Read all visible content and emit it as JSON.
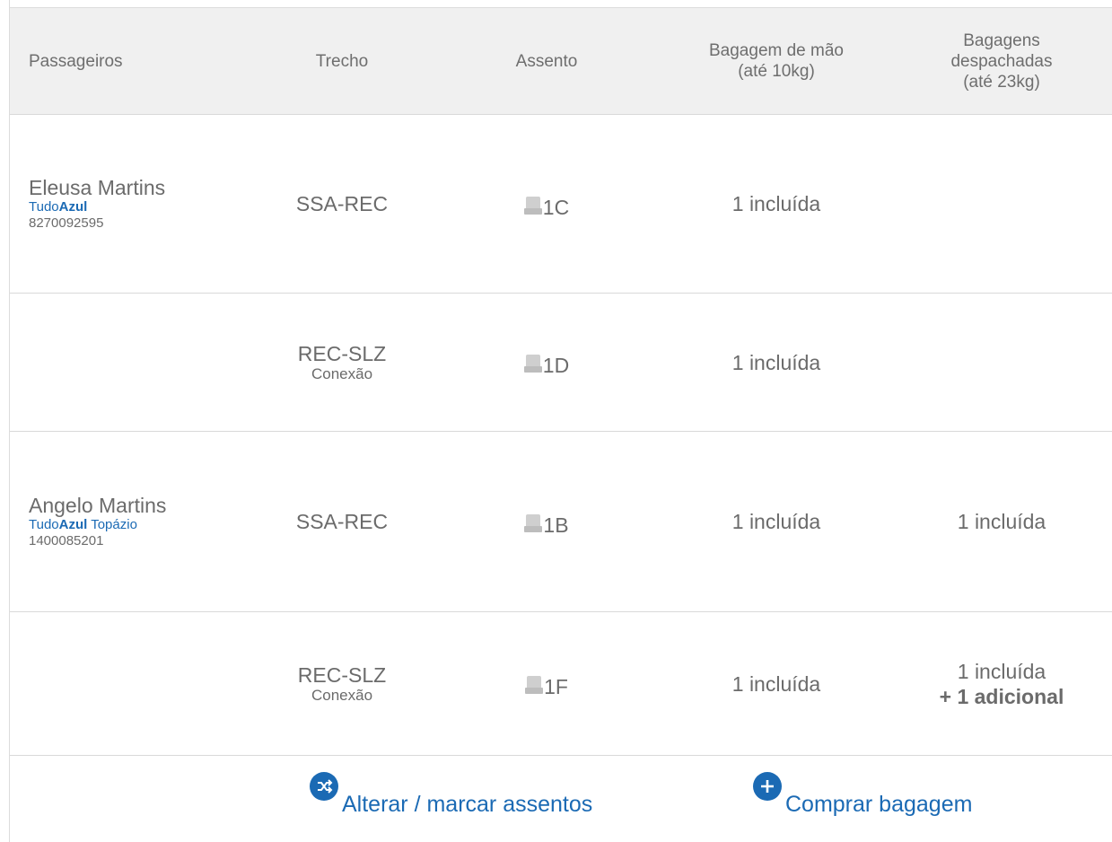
{
  "header": {
    "passengers": "Passageiros",
    "segment": "Trecho",
    "seat": "Assento",
    "carry_on_line1": "Bagagem de mão",
    "carry_on_line2": "(até 10kg)",
    "checked_line1": "Bagagens",
    "checked_line2": "despachadas",
    "checked_line3": "(até 23kg)"
  },
  "rows": [
    {
      "passenger_name": "Eleusa Martins",
      "program_prefix": "Tudo",
      "program_brand": "Azul",
      "program_tier": "",
      "program_number": "8270092595",
      "segment": "SSA-REC",
      "segment_note": "",
      "seat": "1C",
      "carry_on": "1 incluída",
      "checked": "",
      "checked_extra": ""
    },
    {
      "passenger_name": "",
      "program_prefix": "",
      "program_brand": "",
      "program_tier": "",
      "program_number": "",
      "segment": "REC-SLZ",
      "segment_note": "Conexão",
      "seat": "1D",
      "carry_on": "1 incluída",
      "checked": "",
      "checked_extra": ""
    },
    {
      "passenger_name": "Angelo Martins",
      "program_prefix": "Tudo",
      "program_brand": "Azul",
      "program_tier": " Topázio",
      "program_number": "1400085201",
      "segment": "SSA-REC",
      "segment_note": "",
      "seat": "1B",
      "carry_on": "1 incluída",
      "checked": "1 incluída",
      "checked_extra": ""
    },
    {
      "passenger_name": "",
      "program_prefix": "",
      "program_brand": "",
      "program_tier": "",
      "program_number": "",
      "segment": "REC-SLZ",
      "segment_note": "Conexão",
      "seat": "1F",
      "carry_on": "1 incluída",
      "checked": "1 incluída",
      "checked_extra": "+ 1 adicional"
    }
  ],
  "actions": {
    "change_seats": "Alterar / marcar assentos",
    "buy_baggage": "Comprar bagagem"
  },
  "colors": {
    "link": "#1b6ab4",
    "header_bg": "#f0f0f0",
    "text": "#6b6b6b"
  }
}
